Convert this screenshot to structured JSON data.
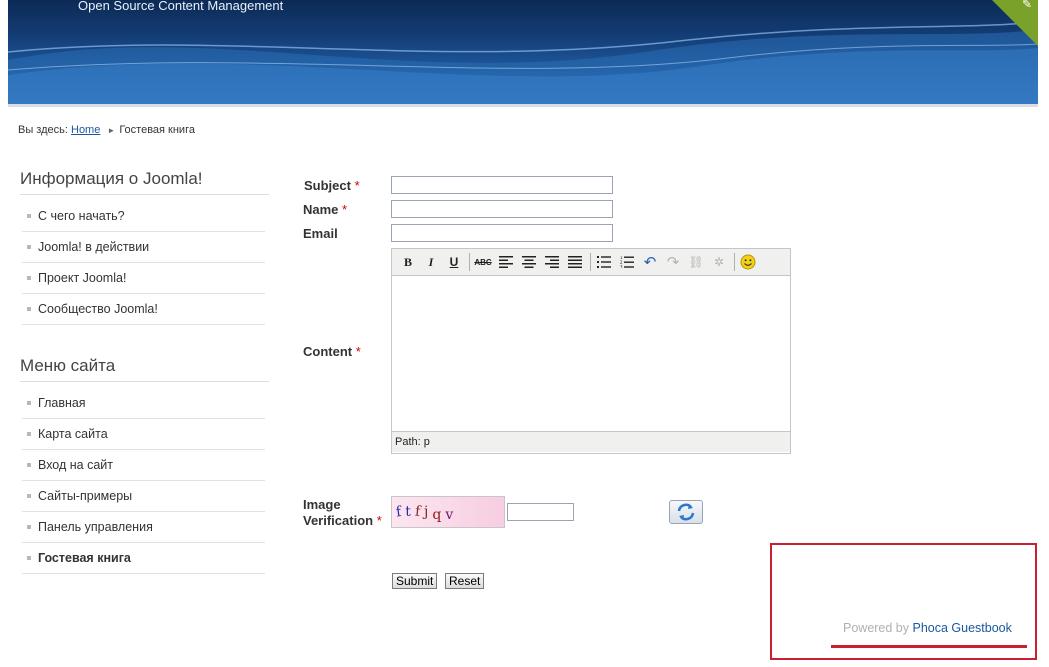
{
  "header": {
    "subtitle": "Open Source Content Management"
  },
  "breadcrumb": {
    "prefix": "Вы здесь:",
    "home": "Home",
    "current": "Гостевая книга"
  },
  "sidebar": {
    "modules": [
      {
        "title": "Информация о Joomla!",
        "items": [
          "С чего начать?",
          "Joomla! в действии",
          "Проект Joomla!",
          "Сообщество Joomla!"
        ]
      },
      {
        "title": "Меню сайта",
        "items": [
          "Главная",
          "Карта сайта",
          "Вход на сайт",
          "Сайты-примеры",
          "Панель управления",
          "Гостевая книга"
        ],
        "active_index": 5
      }
    ]
  },
  "form": {
    "subject_label": "Subject",
    "name_label": "Name",
    "email_label": "Email",
    "content_label": "Content",
    "image_verification_label_1": "Image",
    "image_verification_label_2": "Verification",
    "required_mark": "*",
    "subject_value": "",
    "name_value": "",
    "email_value": "",
    "captcha_value": "",
    "captcha_chars": [
      "f",
      "t",
      "f",
      "j",
      "q",
      "v"
    ],
    "submit_label": "Submit",
    "reset_label": "Reset"
  },
  "editor": {
    "toolbar": {
      "bold": "B",
      "italic": "I",
      "underline": "U",
      "strike": "ABC",
      "align_left": "align-left-icon",
      "align_center": "align-center-icon",
      "align_right": "align-right-icon",
      "justify": "justify-icon",
      "bullist": "bullet-list-icon",
      "numlist": "numbered-list-icon",
      "undo": "undo-icon",
      "redo": "redo-icon",
      "link": "link-icon",
      "unlink": "unlink-icon",
      "emotions": "smiley-icon"
    },
    "path_label": "Path: p"
  },
  "footer": {
    "powered_by": "Powered by",
    "link_text": "Phoca Guestbook"
  },
  "colors": {
    "header_dark": "#0c2a55",
    "link": "#1b57a1",
    "required": "#cc0000",
    "highlight_border": "#c8202c",
    "corner_green": "#7aa22a"
  }
}
